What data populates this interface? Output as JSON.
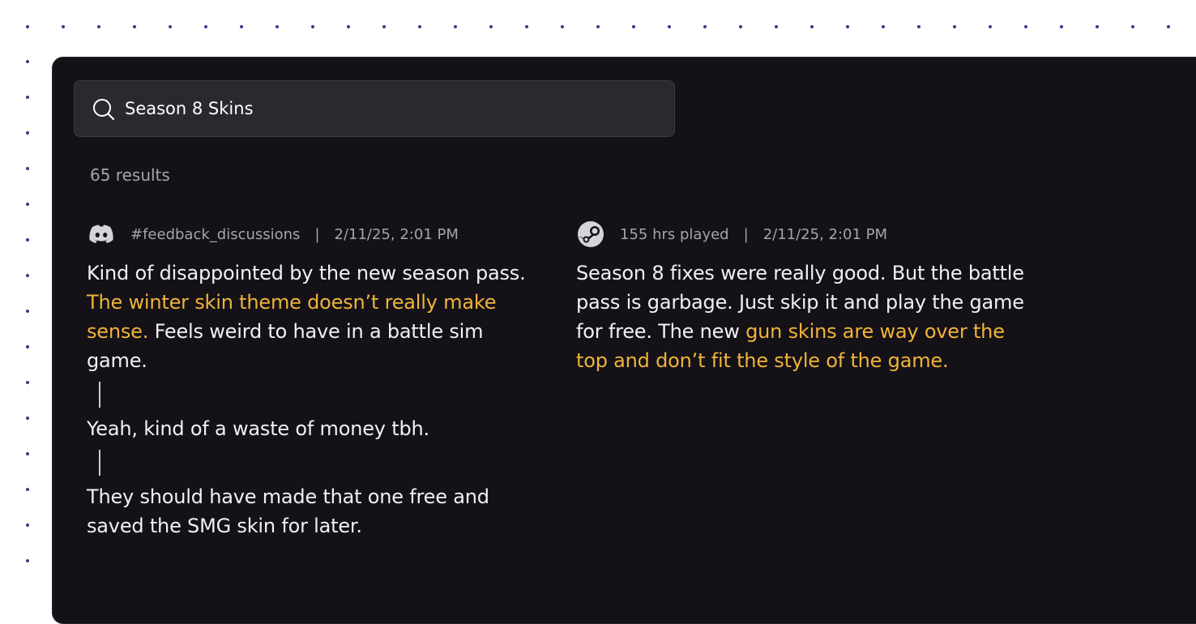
{
  "search": {
    "value": "Season 8 Skins",
    "icon": "search-icon"
  },
  "results": {
    "count_label": "65 results"
  },
  "posts": [
    {
      "source_icon": "discord-icon",
      "channel": "#feedback_discussions",
      "separator": "|",
      "timestamp": "2/11/25, 2:01 PM",
      "messages": [
        {
          "part1": "Kind of disappointed by the new season pass. ",
          "highlight": "The winter skin theme doesn’t really make sense.",
          "part2": " Feels weird to have in a battle sim game."
        },
        {
          "text": "Yeah, kind of a waste of money tbh."
        },
        {
          "text": "They should have made that one free and saved the SMG skin for later."
        }
      ]
    },
    {
      "source_icon": "steam-icon",
      "meta": "155 hrs played",
      "separator": "|",
      "timestamp": "2/11/25, 2:01 PM",
      "part1": "Season 8 fixes were really good. But the battle pass is garbage. Just skip it and play the game for free. The new ",
      "highlight": "gun skins are way over the top and don’t fit the style of the game."
    }
  ],
  "colors": {
    "panel_bg": "#141117",
    "search_bg": "#2b2830",
    "highlight": "#f0b43a",
    "muted_text": "#a7a3ad",
    "dot": "#3b3a8c"
  }
}
